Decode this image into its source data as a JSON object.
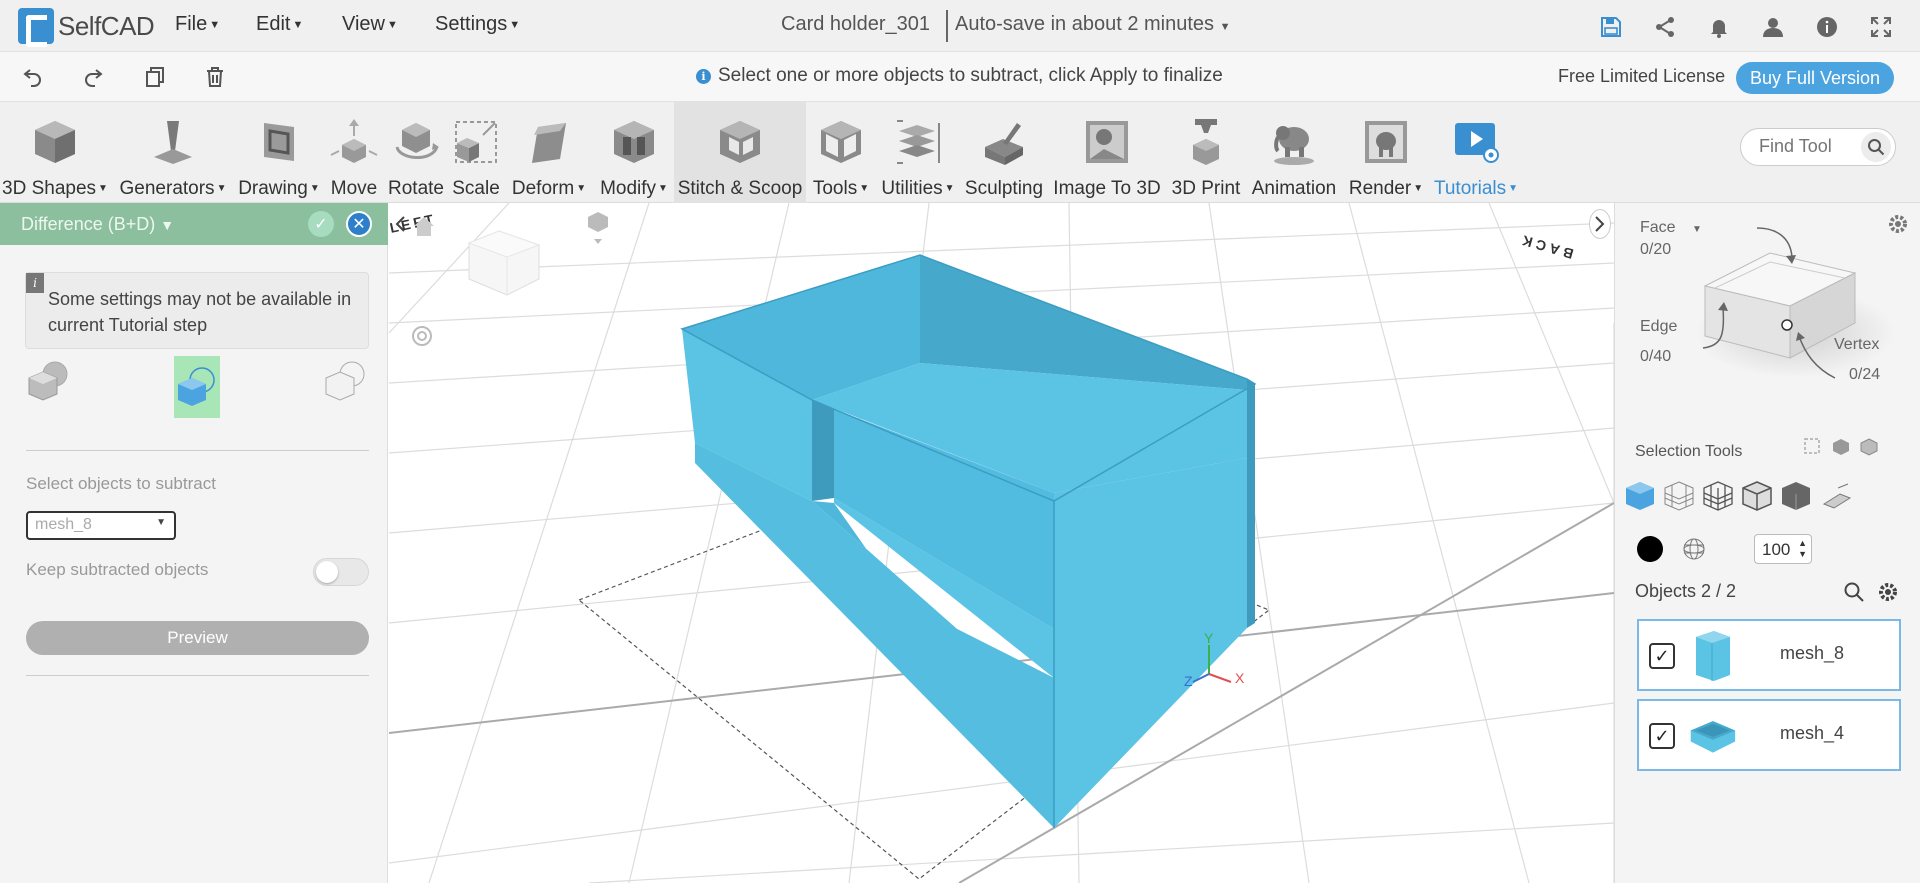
{
  "app": {
    "logo_text": "SelfCAD",
    "document_title": "Card holder_301",
    "autosave_text": "Auto-save in about 2 minutes",
    "menu": [
      "File",
      "Edit",
      "View",
      "Settings"
    ]
  },
  "top_right_icons": [
    "save-icon",
    "share-icon",
    "bell-icon",
    "user-icon",
    "info-icon",
    "fullscreen-icon"
  ],
  "row2": {
    "hint": "Select one or more objects to subtract, click Apply to finalize",
    "license": "Free Limited License",
    "buy_label": "Buy Full Version",
    "icons": [
      "undo-icon",
      "redo-icon",
      "copy-icon",
      "delete-icon"
    ]
  },
  "toolbar": {
    "tools": [
      {
        "label": "3D Shapes",
        "dropdown": true
      },
      {
        "label": "Generators",
        "dropdown": true
      },
      {
        "label": "Drawing",
        "dropdown": true
      },
      {
        "label": "Move",
        "dropdown": false
      },
      {
        "label": "Rotate",
        "dropdown": false
      },
      {
        "label": "Scale",
        "dropdown": false
      },
      {
        "label": "Deform",
        "dropdown": true
      },
      {
        "label": "Modify",
        "dropdown": true
      },
      {
        "label": "Stitch & Scoop",
        "dropdown": false
      },
      {
        "label": "Tools",
        "dropdown": true
      },
      {
        "label": "Utilities",
        "dropdown": true
      },
      {
        "label": "Sculpting",
        "dropdown": false
      },
      {
        "label": "Image To 3D",
        "dropdown": false
      },
      {
        "label": "3D Print",
        "dropdown": false
      },
      {
        "label": "Animation",
        "dropdown": false
      },
      {
        "label": "Render",
        "dropdown": true
      },
      {
        "label": "Tutorials",
        "dropdown": true
      }
    ],
    "find_tool_placeholder": "Find Tool"
  },
  "left_panel": {
    "title": "Difference (B+D)",
    "notice": "Some settings may not be available in current Tutorial step",
    "select_objects_label": "Select objects to subtract",
    "selected_mesh": "mesh_8",
    "keep_label": "Keep subtracted objects",
    "keep_enabled": false,
    "preview_label": "Preview"
  },
  "viewport": {
    "view_cube_labels": [
      "LEFT",
      "BACK"
    ],
    "axis_labels": {
      "x": "X",
      "y": "Y",
      "z": "Z"
    },
    "colors": {
      "model": "#5bc3e4",
      "model_dark": "#46a8cb",
      "x_axis": "#e05050",
      "y_axis": "#3cb04a",
      "z_axis": "#3a6fd0"
    }
  },
  "right_panel": {
    "face_label": "Face",
    "face_count": "0/20",
    "edge_label": "Edge",
    "edge_count": "0/40",
    "vertex_label": "Vertex",
    "vertex_count": "0/24",
    "selection_tools_label": "Selection Tools",
    "opacity_value": "100",
    "objects_label": "Objects 2 / 2",
    "objects": [
      {
        "name": "mesh_8",
        "checked": true
      },
      {
        "name": "mesh_4",
        "checked": true
      }
    ]
  },
  "accent": {
    "blue": "#3a8fd0",
    "green_header": "#8cbf9e",
    "buy_button": "#4ba3e0"
  }
}
